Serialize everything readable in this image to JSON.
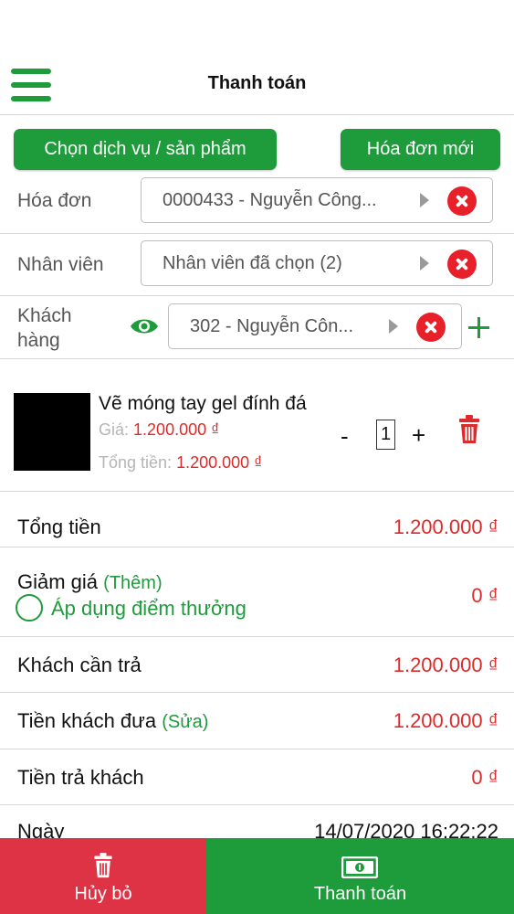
{
  "header": {
    "title": "Thanh toán"
  },
  "actions": {
    "choose_label": "Chọn dịch vụ / sản phẩm",
    "new_invoice_label": "Hóa đơn mới"
  },
  "form": {
    "invoice": {
      "label": "Hóa đơn",
      "value": "0000433 - Nguyễn Công..."
    },
    "staff": {
      "label": "Nhân viên",
      "value": "Nhân viên đã chọn (2)"
    },
    "customer": {
      "label_line1": "Khách",
      "label_line2": "hàng",
      "value": "302 - Nguyễn Côn..."
    }
  },
  "product": {
    "name": "Vẽ móng tay gel đính đá",
    "price_label": "Giá:",
    "price_value": "1.200.000 ₫",
    "total_label": "Tổng tiền:",
    "total_value": "1.200.000 ₫",
    "quantity": "1",
    "minus": "-",
    "plus": "+"
  },
  "summary": {
    "total": {
      "label": "Tổng tiền",
      "value": "1.200.000 ₫"
    },
    "discount": {
      "label": "Giảm giá",
      "link": "(Thêm)",
      "points_label": "Áp dụng điểm thưởng",
      "value": "0 ₫"
    },
    "due": {
      "label": "Khách cần trả",
      "value": "1.200.000 ₫"
    },
    "paid": {
      "label": "Tiền khách đưa",
      "link": "(Sửa)",
      "value": "1.200.000 ₫"
    },
    "change": {
      "label": "Tiền trả khách",
      "value": "0 ₫"
    },
    "date": {
      "label": "Ngày",
      "value": "14/07/2020 16:22:22"
    }
  },
  "footer": {
    "cancel_label": "Hủy bỏ",
    "pay_label": "Thanh toán"
  },
  "colors": {
    "green": "#1e9c3c",
    "red": "#dc2b2b",
    "cancel_bg": "#dd3344"
  }
}
